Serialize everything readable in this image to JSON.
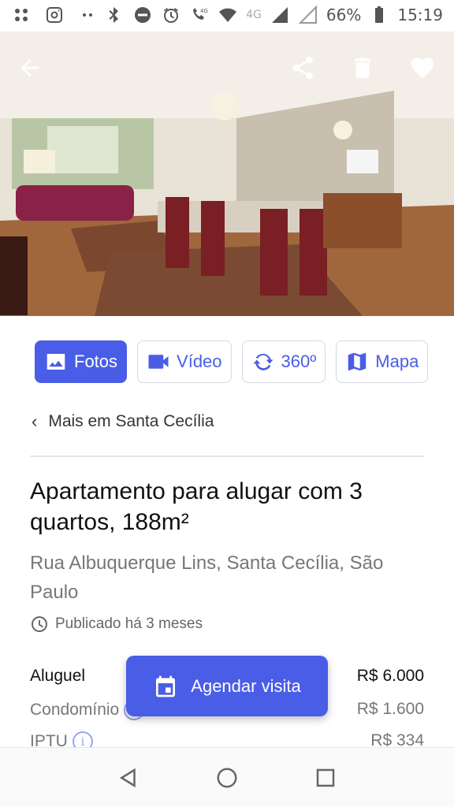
{
  "status_bar": {
    "battery": "66%",
    "time": "15:19",
    "network_small": "4G",
    "network_large": "4G",
    "icons": [
      "slack-icon",
      "instagram-icon",
      "more-dots-icon",
      "bluetooth-icon",
      "dnd-icon",
      "alarm-icon",
      "wifi-call-icon",
      "wifi-icon",
      "signal-icon",
      "battery-icon"
    ]
  },
  "hero": {
    "actions": [
      "back-arrow-icon",
      "share-icon",
      "trash-icon",
      "heart-icon"
    ]
  },
  "media_tabs": [
    {
      "label": "Fotos",
      "icon": "photo-icon",
      "active": true
    },
    {
      "label": "Vídeo",
      "icon": "video-camera-icon",
      "active": false
    },
    {
      "label": "360º",
      "icon": "rotate-360-icon",
      "active": false
    },
    {
      "label": "Mapa",
      "icon": "map-icon",
      "active": false
    }
  ],
  "breadcrumb": {
    "label": "Mais em Santa Cecília"
  },
  "listing": {
    "title": "Apartamento para alugar com 3 quartos, 188m²",
    "address": "Rua Albuquerque Lins, Santa Cecília, São Paulo",
    "published": "Publicado há 3 meses"
  },
  "prices": [
    {
      "label": "Aluguel",
      "value": "R$ 6.000"
    },
    {
      "label": "Condomínio",
      "value": "R$ 1.600"
    },
    {
      "label": "IPTU",
      "value": "R$ 334"
    }
  ],
  "cta": {
    "label": "Agendar visita"
  },
  "colors": {
    "accent": "#4a5de6"
  }
}
